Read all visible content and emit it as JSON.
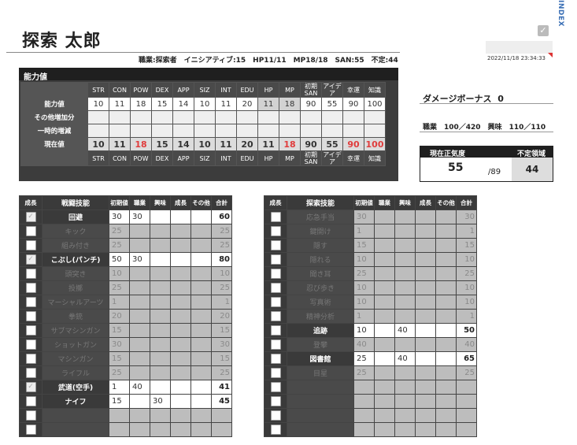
{
  "character": {
    "name": "探索 太郎",
    "info": "職業:探索者　イニシアティブ:15　HP11/11　MP18/18　SAN:55　不定:44",
    "timestamp": "2022/11/18 23:34:33",
    "index_label": "INDEX"
  },
  "stats": {
    "title": "能力値",
    "headers": [
      "STR",
      "CON",
      "POW",
      "DEX",
      "APP",
      "SIZ",
      "INT",
      "EDU",
      "HP",
      "MP",
      "初期SAN",
      "アイデア",
      "幸運",
      "知識"
    ],
    "row_labels": [
      "能力値",
      "その他増加分",
      "一時的増減",
      "現在値"
    ],
    "base": [
      "10",
      "11",
      "18",
      "15",
      "14",
      "10",
      "11",
      "20",
      "11",
      "18",
      "90",
      "55",
      "90",
      "100"
    ],
    "current": [
      "10",
      "11",
      "18",
      "15",
      "14",
      "10",
      "11",
      "20",
      "11",
      "18",
      "90",
      "55",
      "90",
      "100"
    ],
    "current_red": [
      false,
      false,
      true,
      false,
      false,
      false,
      false,
      false,
      false,
      true,
      false,
      false,
      true,
      true
    ]
  },
  "right": {
    "damage_bonus_label": "ダメージボーナス",
    "damage_bonus": "0",
    "points": "職業　100／420　興味　110／110",
    "san_label": "現在正気度",
    "san_value": "55",
    "san_max": "/89",
    "indef_label": "不定領域",
    "indef_value": "44"
  },
  "colors": {
    "dark": "#3a3a3a",
    "red": "#e03c3c",
    "index_blue": "#3a6fb5"
  },
  "skill_headers": [
    "成長",
    "初期値",
    "職業",
    "興味",
    "成長",
    "その他",
    "合計"
  ],
  "combat": {
    "title": "戦闘技能",
    "rows": [
      {
        "grow": true,
        "name": "回避",
        "init": "30",
        "job": "30",
        "int": "",
        "g": "",
        "o": "",
        "total": "60",
        "active": true
      },
      {
        "grow": false,
        "name": "キック",
        "init": "25",
        "job": "",
        "int": "",
        "g": "",
        "o": "",
        "total": "25",
        "active": false
      },
      {
        "grow": false,
        "name": "組み付き",
        "init": "25",
        "job": "",
        "int": "",
        "g": "",
        "o": "",
        "total": "25",
        "active": false
      },
      {
        "grow": true,
        "name": "こぶし(パンチ)",
        "init": "50",
        "job": "30",
        "int": "",
        "g": "",
        "o": "",
        "total": "80",
        "active": true
      },
      {
        "grow": false,
        "name": "頭突き",
        "init": "10",
        "job": "",
        "int": "",
        "g": "",
        "o": "",
        "total": "10",
        "active": false
      },
      {
        "grow": false,
        "name": "投擲",
        "init": "25",
        "job": "",
        "int": "",
        "g": "",
        "o": "",
        "total": "25",
        "active": false
      },
      {
        "grow": false,
        "name": "マーシャルアーツ",
        "init": "1",
        "job": "",
        "int": "",
        "g": "",
        "o": "",
        "total": "1",
        "active": false
      },
      {
        "grow": false,
        "name": "拳銃",
        "init": "20",
        "job": "",
        "int": "",
        "g": "",
        "o": "",
        "total": "20",
        "active": false
      },
      {
        "grow": false,
        "name": "サブマシンガン",
        "init": "15",
        "job": "",
        "int": "",
        "g": "",
        "o": "",
        "total": "15",
        "active": false
      },
      {
        "grow": false,
        "name": "ショットガン",
        "init": "30",
        "job": "",
        "int": "",
        "g": "",
        "o": "",
        "total": "30",
        "active": false
      },
      {
        "grow": false,
        "name": "マシンガン",
        "init": "15",
        "job": "",
        "int": "",
        "g": "",
        "o": "",
        "total": "15",
        "active": false
      },
      {
        "grow": false,
        "name": "ライフル",
        "init": "25",
        "job": "",
        "int": "",
        "g": "",
        "o": "",
        "total": "25",
        "active": false
      },
      {
        "grow": true,
        "name": "武道(空手)",
        "init": "1",
        "job": "40",
        "int": "",
        "g": "",
        "o": "",
        "total": "41",
        "active": true
      },
      {
        "grow": false,
        "name": "ナイフ",
        "init": "15",
        "job": "",
        "int": "30",
        "g": "",
        "o": "",
        "total": "45",
        "active": true
      },
      {
        "grow": false,
        "name": "",
        "init": "",
        "job": "",
        "int": "",
        "g": "",
        "o": "",
        "total": "",
        "active": false,
        "blank": true
      },
      {
        "grow": false,
        "name": "",
        "init": "",
        "job": "",
        "int": "",
        "g": "",
        "o": "",
        "total": "",
        "active": false,
        "blank": true
      }
    ]
  },
  "explore": {
    "title": "探索技能",
    "rows": [
      {
        "grow": false,
        "name": "応急手当",
        "init": "30",
        "job": "",
        "int": "",
        "g": "",
        "o": "",
        "total": "30",
        "active": false
      },
      {
        "grow": false,
        "name": "鍵開け",
        "init": "1",
        "job": "",
        "int": "",
        "g": "",
        "o": "",
        "total": "1",
        "active": false
      },
      {
        "grow": false,
        "name": "隠す",
        "init": "15",
        "job": "",
        "int": "",
        "g": "",
        "o": "",
        "total": "15",
        "active": false
      },
      {
        "grow": false,
        "name": "隠れる",
        "init": "10",
        "job": "",
        "int": "",
        "g": "",
        "o": "",
        "total": "10",
        "active": false
      },
      {
        "grow": false,
        "name": "聞き耳",
        "init": "25",
        "job": "",
        "int": "",
        "g": "",
        "o": "",
        "total": "25",
        "active": false
      },
      {
        "grow": false,
        "name": "忍び歩き",
        "init": "10",
        "job": "",
        "int": "",
        "g": "",
        "o": "",
        "total": "10",
        "active": false
      },
      {
        "grow": false,
        "name": "写真術",
        "init": "10",
        "job": "",
        "int": "",
        "g": "",
        "o": "",
        "total": "10",
        "active": false
      },
      {
        "grow": false,
        "name": "精神分析",
        "init": "1",
        "job": "",
        "int": "",
        "g": "",
        "o": "",
        "total": "1",
        "active": false
      },
      {
        "grow": false,
        "name": "追跡",
        "init": "10",
        "job": "",
        "int": "40",
        "g": "",
        "o": "",
        "total": "50",
        "active": true
      },
      {
        "grow": false,
        "name": "登攀",
        "init": "40",
        "job": "",
        "int": "",
        "g": "",
        "o": "",
        "total": "40",
        "active": false
      },
      {
        "grow": false,
        "name": "図書館",
        "init": "25",
        "job": "",
        "int": "40",
        "g": "",
        "o": "",
        "total": "65",
        "active": true
      },
      {
        "grow": false,
        "name": "目星",
        "init": "25",
        "job": "",
        "int": "",
        "g": "",
        "o": "",
        "total": "25",
        "active": false
      },
      {
        "grow": false,
        "name": "",
        "init": "",
        "job": "",
        "int": "",
        "g": "",
        "o": "",
        "total": "",
        "active": false,
        "blank": true
      },
      {
        "grow": false,
        "name": "",
        "init": "",
        "job": "",
        "int": "",
        "g": "",
        "o": "",
        "total": "",
        "active": false,
        "blank": true
      },
      {
        "grow": false,
        "name": "",
        "init": "",
        "job": "",
        "int": "",
        "g": "",
        "o": "",
        "total": "",
        "active": false,
        "blank": true
      },
      {
        "grow": false,
        "name": "",
        "init": "",
        "job": "",
        "int": "",
        "g": "",
        "o": "",
        "total": "",
        "active": false,
        "blank": true
      }
    ]
  }
}
